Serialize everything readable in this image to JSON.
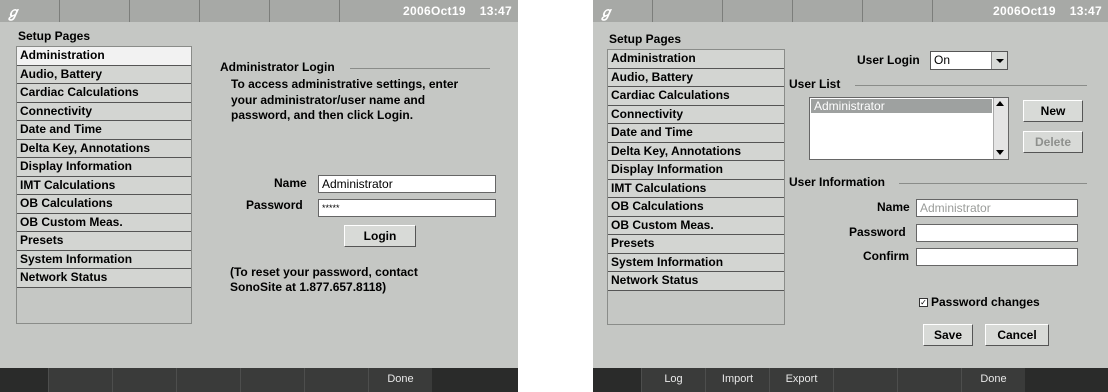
{
  "left_screen": {
    "datetime": {
      "date": "2006Oct19",
      "time": "13:47"
    },
    "setup_pages_title": "Setup Pages",
    "menu_items": [
      "Administration",
      "Audio, Battery",
      "Cardiac Calculations",
      "Connectivity",
      "Date and Time",
      "Delta Key, Annotations",
      "Display Information",
      "IMT Calculations",
      "OB Calculations",
      "OB Custom Meas.",
      "Presets",
      "System Information",
      "Network Status"
    ],
    "login": {
      "heading": "Administrator Login",
      "instructions_line1": "To access administrative settings, enter",
      "instructions_line2": "your administrator/user name and",
      "instructions_line3": "password, and then click Login.",
      "name_label": "Name",
      "name_value": "Administrator",
      "password_label": "Password",
      "password_value": "*****",
      "login_button": "Login",
      "reset_line1": "(To reset your password, contact",
      "reset_line2": "SonoSite at 1.877.657.8118)"
    },
    "bottom_buttons": [
      "",
      "",
      "",
      "",
      "",
      "Done"
    ]
  },
  "right_screen": {
    "datetime": {
      "date": "2006Oct19",
      "time": "13:47"
    },
    "setup_pages_title": "Setup Pages",
    "menu_items": [
      "Administration",
      "Audio, Battery",
      "Cardiac Calculations",
      "Connectivity",
      "Date and Time",
      "Delta Key, Annotations",
      "Display Information",
      "IMT Calculations",
      "OB Calculations",
      "OB Custom Meas.",
      "Presets",
      "System Information",
      "Network Status"
    ],
    "user_login_label": "User Login",
    "user_login_value": "On",
    "user_list_label": "User List",
    "user_list_items": [
      "Administrator"
    ],
    "new_button": "New",
    "delete_button": "Delete",
    "user_info_label": "User Information",
    "name_label": "Name",
    "name_value": "Administrator",
    "password_label": "Password",
    "confirm_label": "Confirm",
    "password_changes_label": "Password changes",
    "password_changes_checked": true,
    "save_button": "Save",
    "cancel_button": "Cancel",
    "bottom_buttons": [
      "Log",
      "Import",
      "Export",
      "",
      "",
      "Done"
    ]
  }
}
